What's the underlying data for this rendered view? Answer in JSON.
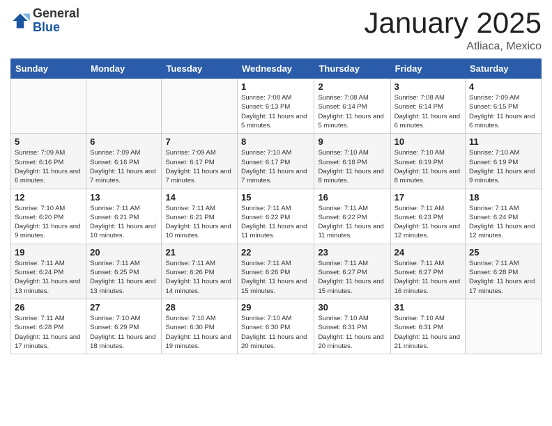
{
  "logo": {
    "general": "General",
    "blue": "Blue"
  },
  "header": {
    "month": "January 2025",
    "location": "Atliaca, Mexico"
  },
  "weekdays": [
    "Sunday",
    "Monday",
    "Tuesday",
    "Wednesday",
    "Thursday",
    "Friday",
    "Saturday"
  ],
  "weeks": [
    [
      {
        "day": "",
        "info": ""
      },
      {
        "day": "",
        "info": ""
      },
      {
        "day": "",
        "info": ""
      },
      {
        "day": "1",
        "sunrise": "7:08 AM",
        "sunset": "6:13 PM",
        "daylight": "11 hours and 5 minutes."
      },
      {
        "day": "2",
        "sunrise": "7:08 AM",
        "sunset": "6:14 PM",
        "daylight": "11 hours and 5 minutes."
      },
      {
        "day": "3",
        "sunrise": "7:08 AM",
        "sunset": "6:14 PM",
        "daylight": "11 hours and 6 minutes."
      },
      {
        "day": "4",
        "sunrise": "7:09 AM",
        "sunset": "6:15 PM",
        "daylight": "11 hours and 6 minutes."
      }
    ],
    [
      {
        "day": "5",
        "sunrise": "7:09 AM",
        "sunset": "6:16 PM",
        "daylight": "11 hours and 6 minutes."
      },
      {
        "day": "6",
        "sunrise": "7:09 AM",
        "sunset": "6:16 PM",
        "daylight": "11 hours and 7 minutes."
      },
      {
        "day": "7",
        "sunrise": "7:09 AM",
        "sunset": "6:17 PM",
        "daylight": "11 hours and 7 minutes."
      },
      {
        "day": "8",
        "sunrise": "7:10 AM",
        "sunset": "6:17 PM",
        "daylight": "11 hours and 7 minutes."
      },
      {
        "day": "9",
        "sunrise": "7:10 AM",
        "sunset": "6:18 PM",
        "daylight": "11 hours and 8 minutes."
      },
      {
        "day": "10",
        "sunrise": "7:10 AM",
        "sunset": "6:19 PM",
        "daylight": "11 hours and 8 minutes."
      },
      {
        "day": "11",
        "sunrise": "7:10 AM",
        "sunset": "6:19 PM",
        "daylight": "11 hours and 9 minutes."
      }
    ],
    [
      {
        "day": "12",
        "sunrise": "7:10 AM",
        "sunset": "6:20 PM",
        "daylight": "11 hours and 9 minutes."
      },
      {
        "day": "13",
        "sunrise": "7:11 AM",
        "sunset": "6:21 PM",
        "daylight": "11 hours and 10 minutes."
      },
      {
        "day": "14",
        "sunrise": "7:11 AM",
        "sunset": "6:21 PM",
        "daylight": "11 hours and 10 minutes."
      },
      {
        "day": "15",
        "sunrise": "7:11 AM",
        "sunset": "6:22 PM",
        "daylight": "11 hours and 11 minutes."
      },
      {
        "day": "16",
        "sunrise": "7:11 AM",
        "sunset": "6:22 PM",
        "daylight": "11 hours and 11 minutes."
      },
      {
        "day": "17",
        "sunrise": "7:11 AM",
        "sunset": "6:23 PM",
        "daylight": "11 hours and 12 minutes."
      },
      {
        "day": "18",
        "sunrise": "7:11 AM",
        "sunset": "6:24 PM",
        "daylight": "11 hours and 12 minutes."
      }
    ],
    [
      {
        "day": "19",
        "sunrise": "7:11 AM",
        "sunset": "6:24 PM",
        "daylight": "11 hours and 13 minutes."
      },
      {
        "day": "20",
        "sunrise": "7:11 AM",
        "sunset": "6:25 PM",
        "daylight": "11 hours and 13 minutes."
      },
      {
        "day": "21",
        "sunrise": "7:11 AM",
        "sunset": "6:26 PM",
        "daylight": "11 hours and 14 minutes."
      },
      {
        "day": "22",
        "sunrise": "7:11 AM",
        "sunset": "6:26 PM",
        "daylight": "11 hours and 15 minutes."
      },
      {
        "day": "23",
        "sunrise": "7:11 AM",
        "sunset": "6:27 PM",
        "daylight": "11 hours and 15 minutes."
      },
      {
        "day": "24",
        "sunrise": "7:11 AM",
        "sunset": "6:27 PM",
        "daylight": "11 hours and 16 minutes."
      },
      {
        "day": "25",
        "sunrise": "7:11 AM",
        "sunset": "6:28 PM",
        "daylight": "11 hours and 17 minutes."
      }
    ],
    [
      {
        "day": "26",
        "sunrise": "7:11 AM",
        "sunset": "6:28 PM",
        "daylight": "11 hours and 17 minutes."
      },
      {
        "day": "27",
        "sunrise": "7:10 AM",
        "sunset": "6:29 PM",
        "daylight": "11 hours and 18 minutes."
      },
      {
        "day": "28",
        "sunrise": "7:10 AM",
        "sunset": "6:30 PM",
        "daylight": "11 hours and 19 minutes."
      },
      {
        "day": "29",
        "sunrise": "7:10 AM",
        "sunset": "6:30 PM",
        "daylight": "11 hours and 20 minutes."
      },
      {
        "day": "30",
        "sunrise": "7:10 AM",
        "sunset": "6:31 PM",
        "daylight": "11 hours and 20 minutes."
      },
      {
        "day": "31",
        "sunrise": "7:10 AM",
        "sunset": "6:31 PM",
        "daylight": "11 hours and 21 minutes."
      },
      {
        "day": "",
        "info": ""
      }
    ]
  ],
  "labels": {
    "sunrise": "Sunrise:",
    "sunset": "Sunset:",
    "daylight": "Daylight:"
  }
}
